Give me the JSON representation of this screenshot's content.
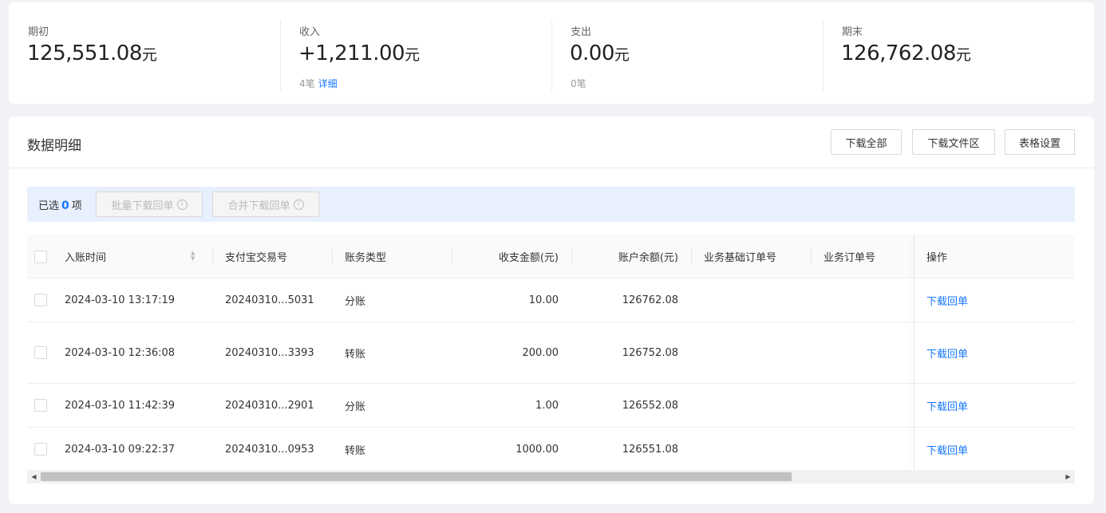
{
  "summary": {
    "items": [
      {
        "label": "期初",
        "value": "125,551.08",
        "unit": "元",
        "sub_count": "",
        "sub_link": ""
      },
      {
        "label": "收入",
        "value": "+1,211.00",
        "unit": "元",
        "sub_count": "4笔",
        "sub_link": "详细"
      },
      {
        "label": "支出",
        "value": "0.00",
        "unit": "元",
        "sub_count": "0笔",
        "sub_link": ""
      },
      {
        "label": "期末",
        "value": "126,762.08",
        "unit": "元",
        "sub_count": "",
        "sub_link": ""
      }
    ]
  },
  "detail": {
    "title": "数据明细",
    "buttons": {
      "download_all": "下载全部",
      "download_area": "下载文件区",
      "table_settings": "表格设置"
    }
  },
  "selection": {
    "prefix": "已选",
    "count": "0",
    "suffix": "项",
    "batch_download": "批量下载回单",
    "merge_download": "合并下载回单",
    "info_glyph": "i"
  },
  "table": {
    "columns": {
      "time": "入账时间",
      "trade_no": "支付宝交易号",
      "type": "账务类型",
      "amount": "收支金额(元)",
      "balance": "账户余额(元)",
      "base_order": "业务基础订单号",
      "order": "业务订单号",
      "action": "操作"
    },
    "rows": [
      {
        "time": "2024-03-10 13:17:19",
        "trade_no": "20240310...5031",
        "type": "分账",
        "amount": "10.00",
        "balance": "126762.08",
        "base_order": "",
        "order": "",
        "action": "下载回单"
      },
      {
        "time": "2024-03-10 12:36:08",
        "trade_no": "20240310...3393",
        "type": "转账",
        "amount": "200.00",
        "balance": "126752.08",
        "base_order": "",
        "order": "",
        "action": "下载回单"
      },
      {
        "time": "2024-03-10 11:42:39",
        "trade_no": "20240310...2901",
        "type": "分账",
        "amount": "1.00",
        "balance": "126552.08",
        "base_order": "",
        "order": "",
        "action": "下载回单"
      },
      {
        "time": "2024-03-10 09:22:37",
        "trade_no": "20240310...0953",
        "type": "转账",
        "amount": "1000.00",
        "balance": "126551.08",
        "base_order": "",
        "order": "",
        "action": "下载回单"
      }
    ]
  },
  "icons": {
    "sort_up": "▲",
    "sort_down": "▼",
    "scroll_left": "◀",
    "scroll_right": "▶"
  },
  "colors": {
    "accent": "#1677ff",
    "selection_bar": "#e8f0fe",
    "background": "#f0f2f5"
  }
}
